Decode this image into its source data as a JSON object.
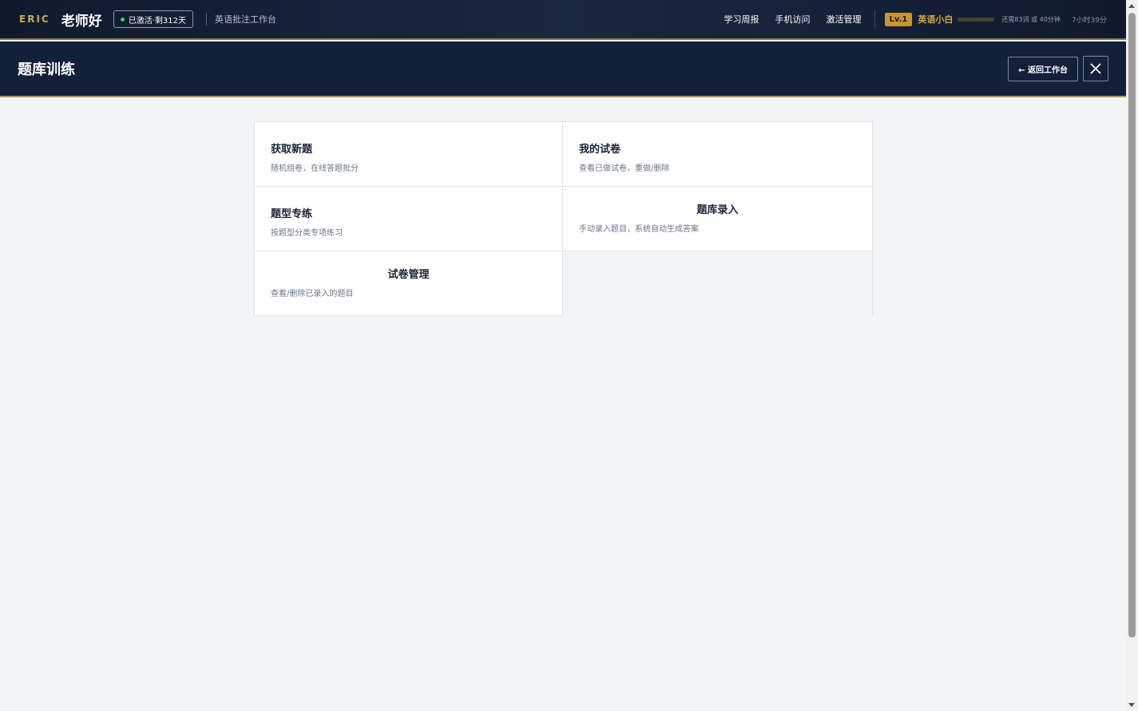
{
  "topbar": {
    "brand": "ERIC",
    "greeting": "老师好",
    "status_badge": "已激活·剩312天",
    "workspace_name": "英语批注工作台",
    "nav": [
      "学习周报",
      "手机访问",
      "激活管理"
    ],
    "level_badge": "Lv.1",
    "rank_title": "英语小白",
    "xp_progress_percent": 100,
    "xp_remaining": "还需83词 或 40分钟",
    "study_time": "7小时39分",
    "accent_color": "#c9962e"
  },
  "header": {
    "title": "题库训练",
    "back_label": "← 返回工作台",
    "close_icon": "close-icon"
  },
  "cards": [
    {
      "title": "获取新题",
      "desc": "随机组卷，在线答题批分"
    },
    {
      "title": "我的试卷",
      "desc": "查看已做试卷，重做/删除"
    },
    {
      "title": "题型专练",
      "desc": "按题型分类专项练习"
    },
    {
      "title": "题库录入",
      "desc": "手动录入题目，系统自动生成答案"
    },
    {
      "title": "试卷管理",
      "desc": "查看/删除已录入的题目"
    }
  ]
}
